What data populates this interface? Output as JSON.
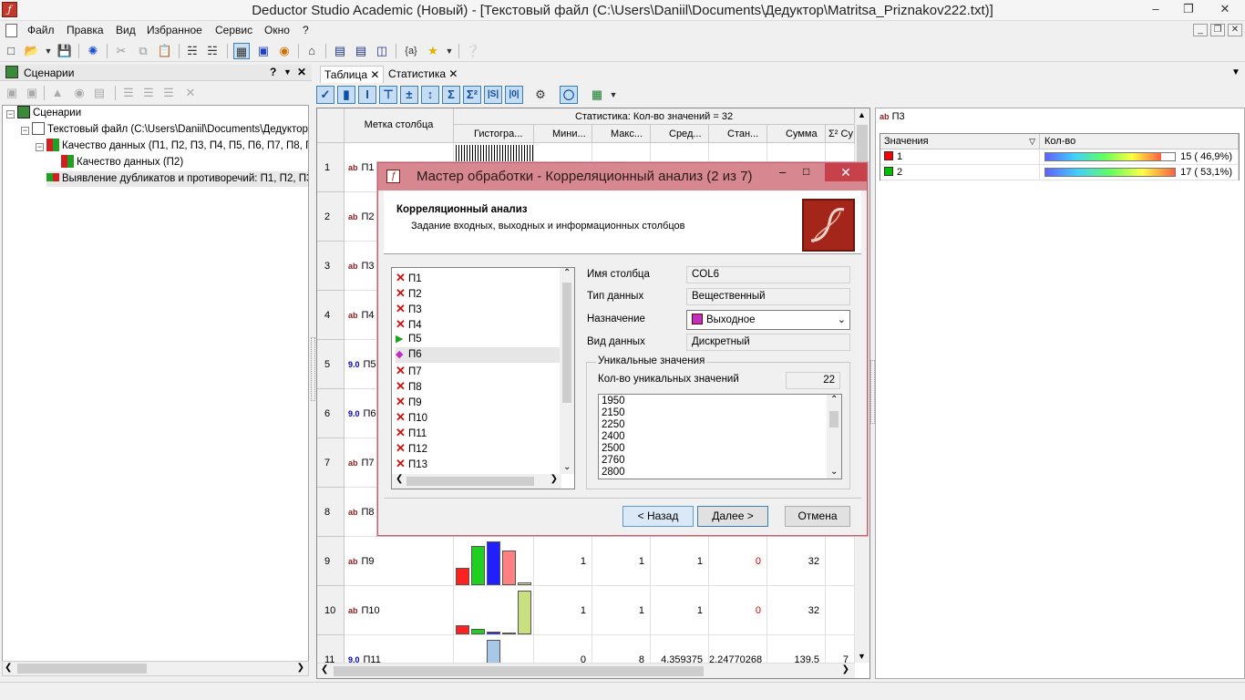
{
  "window": {
    "title": "Deductor Studio Academic (Новый) - [Текстовый файл (C:\\Users\\Daniil\\Documents\\Дедуктор\\Matritsa_Priznakov222.txt)]"
  },
  "menu": [
    "Файл",
    "Правка",
    "Вид",
    "Избранное",
    "Сервис",
    "Окно",
    "?"
  ],
  "toolbar": {
    "curly": "{a}"
  },
  "scenarios": {
    "title": "Сценарии",
    "help": "?",
    "close": "✕",
    "tree": [
      {
        "label": "Сценарии"
      },
      {
        "label": "Текстовый файл (C:\\Users\\Daniil\\Documents\\Дедуктор\\M"
      },
      {
        "label": "Качество данных (П1, П2, П3, П4, П5, П6, П7, П8, П9,"
      },
      {
        "label": "Качество данных (П2)"
      },
      {
        "label": "Выявление дубликатов и противоречий: П1, П2, П3, П"
      }
    ]
  },
  "tabs": [
    {
      "label": "Таблица",
      "close": "✕"
    },
    {
      "label": "Статистика",
      "close": "✕"
    }
  ],
  "stats_tools": [
    "✓",
    "▮",
    "I",
    "⊤",
    "±",
    "↕",
    "Σ",
    "Σ²",
    "|S|",
    "|0|"
  ],
  "grid": {
    "col_label_header": "Метка столбца",
    "stats_caption": "Статистика: Кол-во значений = 32",
    "columns": [
      "Гистогра...",
      "Мини...",
      "Макс...",
      "Сред...",
      "Стан...",
      "Сумма",
      "Σ² Су"
    ],
    "rows": [
      {
        "n": "1",
        "type": "ab",
        "name": "П1",
        "min": "",
        "max": "",
        "mean": "",
        "std": "",
        "sum": ""
      },
      {
        "n": "2",
        "type": "ab",
        "name": "П2",
        "min": "",
        "max": "",
        "mean": "",
        "std": "",
        "sum": ""
      },
      {
        "n": "3",
        "type": "ab",
        "name": "П3",
        "min": "",
        "max": "",
        "mean": "",
        "std": "",
        "sum": ""
      },
      {
        "n": "4",
        "type": "ab",
        "name": "П4",
        "min": "",
        "max": "",
        "mean": "",
        "std": "",
        "sum": ""
      },
      {
        "n": "5",
        "type": "9.0",
        "name": "П5",
        "min": "",
        "max": "",
        "mean": "",
        "std": "",
        "sum": ""
      },
      {
        "n": "6",
        "type": "9.0",
        "name": "П6",
        "min": "",
        "max": "",
        "mean": "",
        "std": "",
        "sum": ""
      },
      {
        "n": "7",
        "type": "ab",
        "name": "П7",
        "min": "",
        "max": "",
        "mean": "",
        "std": "",
        "sum": ""
      },
      {
        "n": "8",
        "type": "ab",
        "name": "П8",
        "min": "",
        "max": "",
        "mean": "",
        "std": "",
        "sum": ""
      },
      {
        "n": "9",
        "type": "ab",
        "name": "П9",
        "min": "1",
        "max": "1",
        "mean": "1",
        "std": "0",
        "sum": "32"
      },
      {
        "n": "10",
        "type": "ab",
        "name": "П10",
        "min": "1",
        "max": "1",
        "mean": "1",
        "std": "0",
        "sum": "32"
      },
      {
        "n": "11",
        "type": "9.0",
        "name": "П11",
        "min": "0",
        "max": "8",
        "mean": "4,359375",
        "std": "2,24770268",
        "sum": "139,5",
        "sq": "7"
      }
    ],
    "hist9": [
      {
        "v": 0.4,
        "c": "#ff2020"
      },
      {
        "v": 0.9,
        "c": "#20d020"
      },
      {
        "v": 1.0,
        "c": "#2020ff"
      },
      {
        "v": 0.8,
        "c": "#ff8080"
      },
      {
        "v": 0.07,
        "c": "#d8e890"
      }
    ],
    "hist10": [
      {
        "v": 0.2,
        "c": "#ff2020"
      },
      {
        "v": 0.13,
        "c": "#20d020"
      },
      {
        "v": 0.07,
        "c": "#2020ff"
      },
      {
        "v": 0.03,
        "c": "#ff8080"
      },
      {
        "v": 1.0,
        "c": "#c8e080"
      }
    ],
    "hist11": [
      {
        "v": 0.0,
        "c": "#cfe4f4"
      },
      {
        "v": 0.0,
        "c": "#cfe4f4"
      },
      {
        "v": 1.0,
        "c": "#a8c8e8"
      },
      {
        "v": 0.3,
        "c": "#a8c8e8"
      }
    ]
  },
  "right": {
    "field_type": "ab",
    "field": "П3",
    "col_values": "Значения",
    "col_count": "Кол-во",
    "rows": [
      {
        "value": "1",
        "color": "#ff0000",
        "text": "15 ( 46,9%)",
        "share": 0.469
      },
      {
        "value": "2",
        "color": "#00c000",
        "text": "17 ( 53,1%)",
        "share": 0.531
      }
    ]
  },
  "dialog": {
    "title": "Мастер обработки - Корреляционный анализ (2 из 7)",
    "heading": "Корреляционный анализ",
    "subheading": "Задание входных, выходных и информационных столбцов",
    "columns": [
      {
        "name": "П1",
        "role": "unused"
      },
      {
        "name": "П2",
        "role": "unused"
      },
      {
        "name": "П3",
        "role": "unused"
      },
      {
        "name": "П4",
        "role": "unused"
      },
      {
        "name": "П5",
        "role": "input"
      },
      {
        "name": "П6",
        "role": "output"
      },
      {
        "name": "П7",
        "role": "unused"
      },
      {
        "name": "П8",
        "role": "unused"
      },
      {
        "name": "П9",
        "role": "unused"
      },
      {
        "name": "П10",
        "role": "unused"
      },
      {
        "name": "П11",
        "role": "unused"
      },
      {
        "name": "П12",
        "role": "unused"
      },
      {
        "name": "П13",
        "role": "unused"
      }
    ],
    "labels": {
      "col_name": "Имя столбца",
      "data_type": "Тип данных",
      "purpose": "Назначение",
      "kind": "Вид данных",
      "unique_group": "Уникальные значения",
      "unique_count": "Кол-во уникальных значений"
    },
    "values": {
      "col_name": "COL6",
      "data_type": "Вещественный",
      "purpose": "Выходное",
      "kind": "Дискретный",
      "unique_count": "22"
    },
    "unique_values": [
      "1950",
      "2150",
      "2250",
      "2400",
      "2500",
      "2760",
      "2800"
    ],
    "buttons": {
      "back": "< Назад",
      "next": "Далее >",
      "cancel": "Отмена"
    }
  }
}
